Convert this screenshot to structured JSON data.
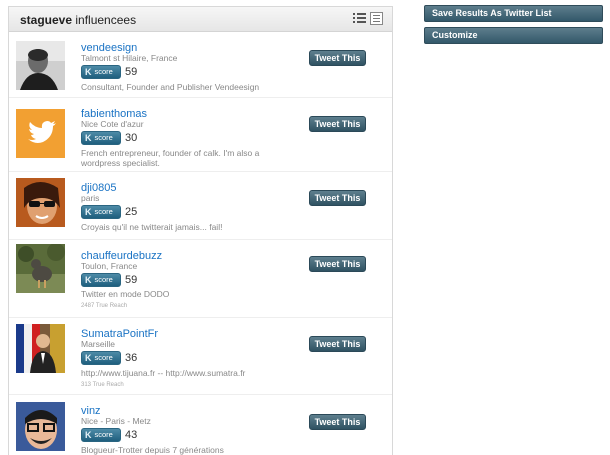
{
  "header": {
    "username": "stagueve",
    "title": " influencees"
  },
  "tweet_label": "Tweet This",
  "score_label": "score",
  "sidebar": {
    "save_button": "Save Results As Twitter List",
    "customize_button": "Customize"
  },
  "items": [
    {
      "name": "vendeesign",
      "location": "Talmont st Hilaire, France",
      "score": "59",
      "bio": "Consultant, Founder and Publisher Vendeesign",
      "reach": ""
    },
    {
      "name": "fabienthomas",
      "location": "Nice Cote d'azur",
      "score": "30",
      "bio": "French entrepreneur, founder of calk. I'm also a wordpress specialist.",
      "reach": ""
    },
    {
      "name": "dji0805",
      "location": "paris",
      "score": "25",
      "bio": "Croyais qu'il ne twitterait jamais... fail!",
      "reach": ""
    },
    {
      "name": "chauffeurdebuzz",
      "location": "Toulon, France",
      "score": "59",
      "bio": "Twitter en mode DODO",
      "reach": "2487 True Reach"
    },
    {
      "name": "SumatraPointFr",
      "location": "Marseille",
      "score": "36",
      "bio": "http://www.tijuana.fr -- http://www.sumatra.fr",
      "reach": "313 True Reach"
    },
    {
      "name": "vinz",
      "location": "Nice - Paris - Metz",
      "score": "43",
      "bio": "Blogueur-Trotter depuis 7 générations",
      "reach": ""
    }
  ]
}
